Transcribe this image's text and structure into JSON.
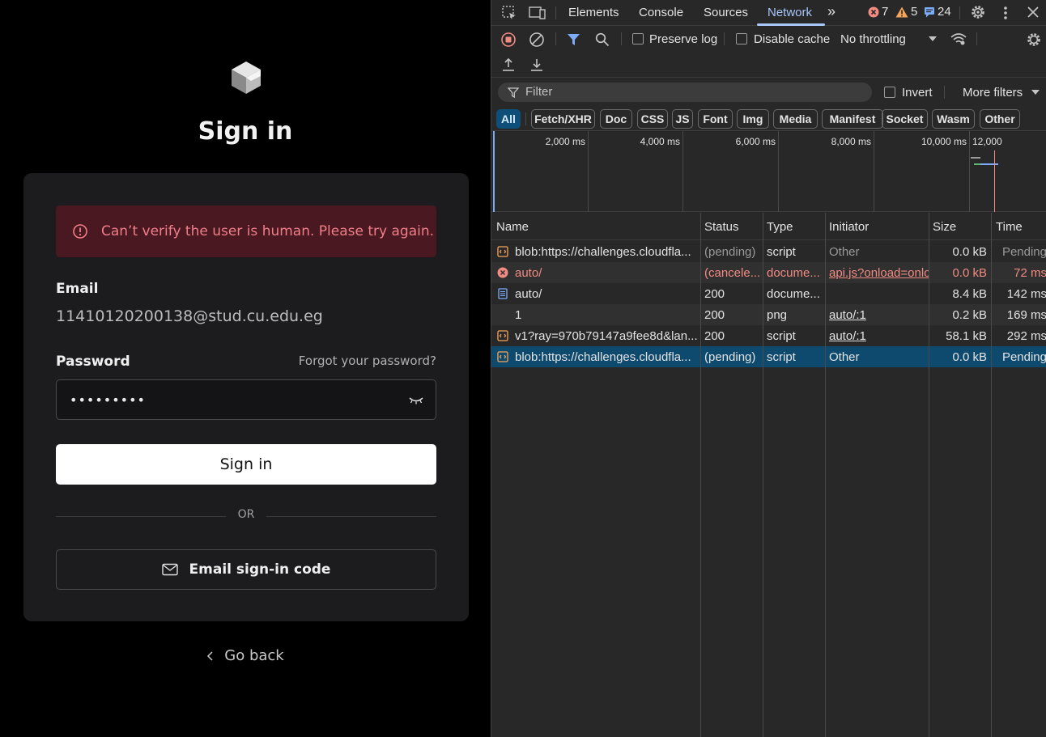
{
  "signin": {
    "title": "Sign in",
    "error": "Can’t verify the user is human. Please try again.",
    "email_label": "Email",
    "email_value": "11410120200138@stud.cu.edu.eg",
    "password_label": "Password",
    "forgot": "Forgot your password?",
    "password_mask": "•••••••••",
    "signin_button": "Sign in",
    "or": "OR",
    "email_code_button": "Email sign-in code",
    "go_back": "Go back"
  },
  "devtools": {
    "tabs": [
      "Elements",
      "Console",
      "Sources",
      "Network"
    ],
    "active_tab": "Network",
    "errors": "7",
    "warnings": "5",
    "messages": "24",
    "preserve_log": "Preserve log",
    "disable_cache": "Disable cache",
    "throttling": "No throttling",
    "filter_placeholder": "Filter",
    "invert": "Invert",
    "more_filters": "More filters",
    "chips": [
      "All",
      "Fetch/XHR",
      "Doc",
      "CSS",
      "JS",
      "Font",
      "Img",
      "Media",
      "Manifest",
      "Socket",
      "Wasm",
      "Other"
    ],
    "timeline_ticks": [
      "2,000 ms",
      "4,000 ms",
      "6,000 ms",
      "8,000 ms",
      "10,000 ms",
      "12,000"
    ],
    "columns": [
      "Name",
      "Status",
      "Type",
      "Initiator",
      "Size",
      "Time"
    ],
    "rows": [
      {
        "name": "blob:https://challenges.cloudfla...",
        "status": "(pending)",
        "type": "script",
        "initiator": "Other",
        "size": "0.0 kB",
        "time": "Pending"
      },
      {
        "name": "auto/",
        "status": "(cancele...",
        "type": "docume...",
        "initiator": "api.js?onload=onlo",
        "size": "0.0 kB",
        "time": "72 ms"
      },
      {
        "name": "auto/",
        "status": "200",
        "type": "docume...",
        "initiator": "",
        "size": "8.4 kB",
        "time": "142 ms"
      },
      {
        "name": "1",
        "status": "200",
        "type": "png",
        "initiator": "auto/:1",
        "size": "0.2 kB",
        "time": "169 ms"
      },
      {
        "name": "v1?ray=970b79147a9fee8d&lan...",
        "status": "200",
        "type": "script",
        "initiator": "auto/:1",
        "size": "58.1 kB",
        "time": "292 ms"
      },
      {
        "name": "blob:https://challenges.cloudfla...",
        "status": "(pending)",
        "type": "script",
        "initiator": "Other",
        "size": "0.0 kB",
        "time": "Pending"
      }
    ]
  }
}
